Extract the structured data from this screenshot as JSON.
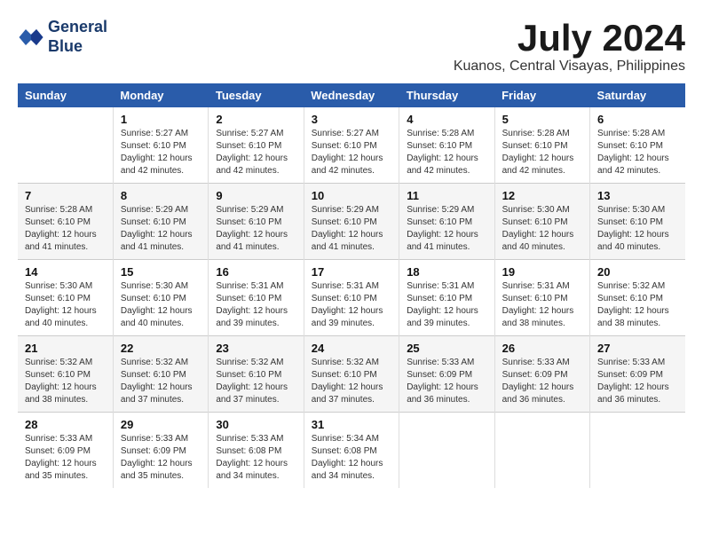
{
  "header": {
    "logo_line1": "General",
    "logo_line2": "Blue",
    "title": "July 2024",
    "subtitle": "Kuanos, Central Visayas, Philippines"
  },
  "calendar": {
    "days_of_week": [
      "Sunday",
      "Monday",
      "Tuesday",
      "Wednesday",
      "Thursday",
      "Friday",
      "Saturday"
    ],
    "weeks": [
      [
        {
          "day": "",
          "info": ""
        },
        {
          "day": "1",
          "info": "Sunrise: 5:27 AM\nSunset: 6:10 PM\nDaylight: 12 hours\nand 42 minutes."
        },
        {
          "day": "2",
          "info": "Sunrise: 5:27 AM\nSunset: 6:10 PM\nDaylight: 12 hours\nand 42 minutes."
        },
        {
          "day": "3",
          "info": "Sunrise: 5:27 AM\nSunset: 6:10 PM\nDaylight: 12 hours\nand 42 minutes."
        },
        {
          "day": "4",
          "info": "Sunrise: 5:28 AM\nSunset: 6:10 PM\nDaylight: 12 hours\nand 42 minutes."
        },
        {
          "day": "5",
          "info": "Sunrise: 5:28 AM\nSunset: 6:10 PM\nDaylight: 12 hours\nand 42 minutes."
        },
        {
          "day": "6",
          "info": "Sunrise: 5:28 AM\nSunset: 6:10 PM\nDaylight: 12 hours\nand 42 minutes."
        }
      ],
      [
        {
          "day": "7",
          "info": "Sunrise: 5:28 AM\nSunset: 6:10 PM\nDaylight: 12 hours\nand 41 minutes."
        },
        {
          "day": "8",
          "info": "Sunrise: 5:29 AM\nSunset: 6:10 PM\nDaylight: 12 hours\nand 41 minutes."
        },
        {
          "day": "9",
          "info": "Sunrise: 5:29 AM\nSunset: 6:10 PM\nDaylight: 12 hours\nand 41 minutes."
        },
        {
          "day": "10",
          "info": "Sunrise: 5:29 AM\nSunset: 6:10 PM\nDaylight: 12 hours\nand 41 minutes."
        },
        {
          "day": "11",
          "info": "Sunrise: 5:29 AM\nSunset: 6:10 PM\nDaylight: 12 hours\nand 41 minutes."
        },
        {
          "day": "12",
          "info": "Sunrise: 5:30 AM\nSunset: 6:10 PM\nDaylight: 12 hours\nand 40 minutes."
        },
        {
          "day": "13",
          "info": "Sunrise: 5:30 AM\nSunset: 6:10 PM\nDaylight: 12 hours\nand 40 minutes."
        }
      ],
      [
        {
          "day": "14",
          "info": "Sunrise: 5:30 AM\nSunset: 6:10 PM\nDaylight: 12 hours\nand 40 minutes."
        },
        {
          "day": "15",
          "info": "Sunrise: 5:30 AM\nSunset: 6:10 PM\nDaylight: 12 hours\nand 40 minutes."
        },
        {
          "day": "16",
          "info": "Sunrise: 5:31 AM\nSunset: 6:10 PM\nDaylight: 12 hours\nand 39 minutes."
        },
        {
          "day": "17",
          "info": "Sunrise: 5:31 AM\nSunset: 6:10 PM\nDaylight: 12 hours\nand 39 minutes."
        },
        {
          "day": "18",
          "info": "Sunrise: 5:31 AM\nSunset: 6:10 PM\nDaylight: 12 hours\nand 39 minutes."
        },
        {
          "day": "19",
          "info": "Sunrise: 5:31 AM\nSunset: 6:10 PM\nDaylight: 12 hours\nand 38 minutes."
        },
        {
          "day": "20",
          "info": "Sunrise: 5:32 AM\nSunset: 6:10 PM\nDaylight: 12 hours\nand 38 minutes."
        }
      ],
      [
        {
          "day": "21",
          "info": "Sunrise: 5:32 AM\nSunset: 6:10 PM\nDaylight: 12 hours\nand 38 minutes."
        },
        {
          "day": "22",
          "info": "Sunrise: 5:32 AM\nSunset: 6:10 PM\nDaylight: 12 hours\nand 37 minutes."
        },
        {
          "day": "23",
          "info": "Sunrise: 5:32 AM\nSunset: 6:10 PM\nDaylight: 12 hours\nand 37 minutes."
        },
        {
          "day": "24",
          "info": "Sunrise: 5:32 AM\nSunset: 6:10 PM\nDaylight: 12 hours\nand 37 minutes."
        },
        {
          "day": "25",
          "info": "Sunrise: 5:33 AM\nSunset: 6:09 PM\nDaylight: 12 hours\nand 36 minutes."
        },
        {
          "day": "26",
          "info": "Sunrise: 5:33 AM\nSunset: 6:09 PM\nDaylight: 12 hours\nand 36 minutes."
        },
        {
          "day": "27",
          "info": "Sunrise: 5:33 AM\nSunset: 6:09 PM\nDaylight: 12 hours\nand 36 minutes."
        }
      ],
      [
        {
          "day": "28",
          "info": "Sunrise: 5:33 AM\nSunset: 6:09 PM\nDaylight: 12 hours\nand 35 minutes."
        },
        {
          "day": "29",
          "info": "Sunrise: 5:33 AM\nSunset: 6:09 PM\nDaylight: 12 hours\nand 35 minutes."
        },
        {
          "day": "30",
          "info": "Sunrise: 5:33 AM\nSunset: 6:08 PM\nDaylight: 12 hours\nand 34 minutes."
        },
        {
          "day": "31",
          "info": "Sunrise: 5:34 AM\nSunset: 6:08 PM\nDaylight: 12 hours\nand 34 minutes."
        },
        {
          "day": "",
          "info": ""
        },
        {
          "day": "",
          "info": ""
        },
        {
          "day": "",
          "info": ""
        }
      ]
    ]
  }
}
